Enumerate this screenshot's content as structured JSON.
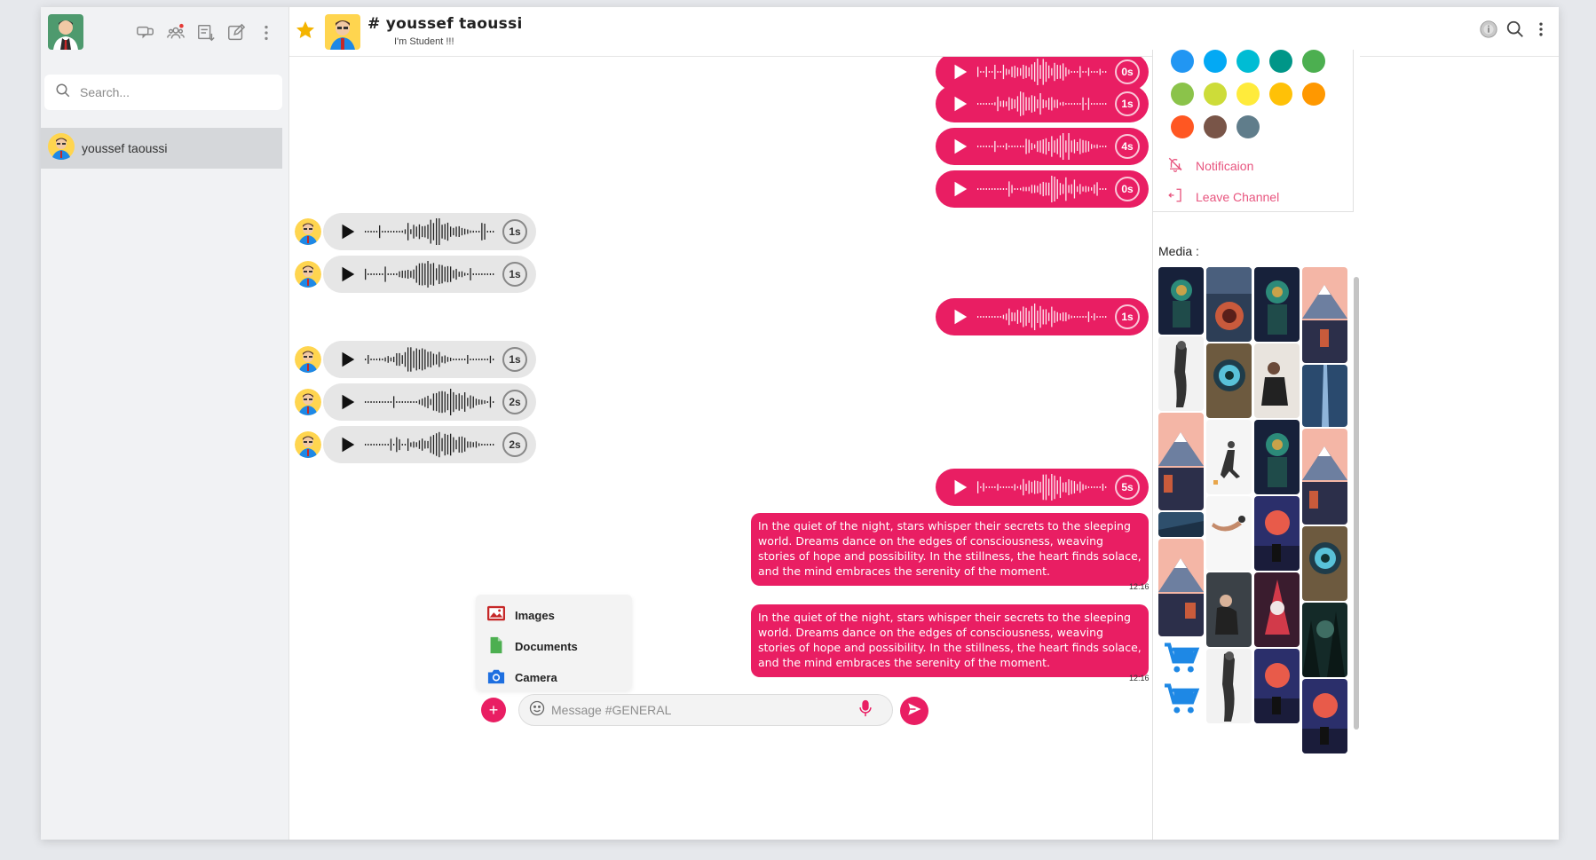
{
  "sidebar": {
    "search_placeholder": "Search...",
    "contacts": [
      {
        "name": "youssef taoussi"
      }
    ]
  },
  "header": {
    "title": "# youssef taoussi",
    "subtitle": "I'm Student !!!"
  },
  "messages": {
    "voice": [
      {
        "side": "out",
        "duration": "0s"
      },
      {
        "side": "out",
        "duration": "1s"
      },
      {
        "side": "out",
        "duration": "4s"
      },
      {
        "side": "out",
        "duration": "0s"
      },
      {
        "side": "in",
        "duration": "1s"
      },
      {
        "side": "in",
        "duration": "1s"
      },
      {
        "side": "out",
        "duration": "1s"
      },
      {
        "side": "in",
        "duration": "1s"
      },
      {
        "side": "in",
        "duration": "2s"
      },
      {
        "side": "in",
        "duration": "2s"
      },
      {
        "side": "out",
        "duration": "5s"
      }
    ],
    "text": [
      {
        "body": "In the quiet of the night, stars whisper their secrets to the sleeping world. Dreams dance on the edges of consciousness, weaving stories of hope and possibility. In the stillness, the heart finds solace, and the mind embraces the serenity of the moment.",
        "time": "12:16"
      },
      {
        "body": "In the quiet of the night, stars whisper their secrets to the sleeping world. Dreams dance on the edges of consciousness, weaving stories of hope and possibility. In the stillness, the heart finds solace, and the mind embraces the serenity of the moment.",
        "time": "12:16"
      }
    ]
  },
  "attach_menu": {
    "images": "Images",
    "documents": "Documents",
    "camera": "Camera"
  },
  "composer": {
    "placeholder": "Message #GENERAL"
  },
  "right_panel": {
    "swatches": [
      "#2196f3",
      "#03a9f4",
      "#00bcd4",
      "#009688",
      "#4caf50",
      "#8bc34a",
      "#cddc39",
      "#ffeb3b",
      "#ffc107",
      "#ff9800",
      "#ff5722",
      "#795548",
      "#607d8b"
    ],
    "notification": "Notificaion",
    "leave": "Leave Channel",
    "media_label": "Media :"
  },
  "colors": {
    "accent": "#e91e63",
    "incoming_bubble": "#e6e6e6"
  }
}
